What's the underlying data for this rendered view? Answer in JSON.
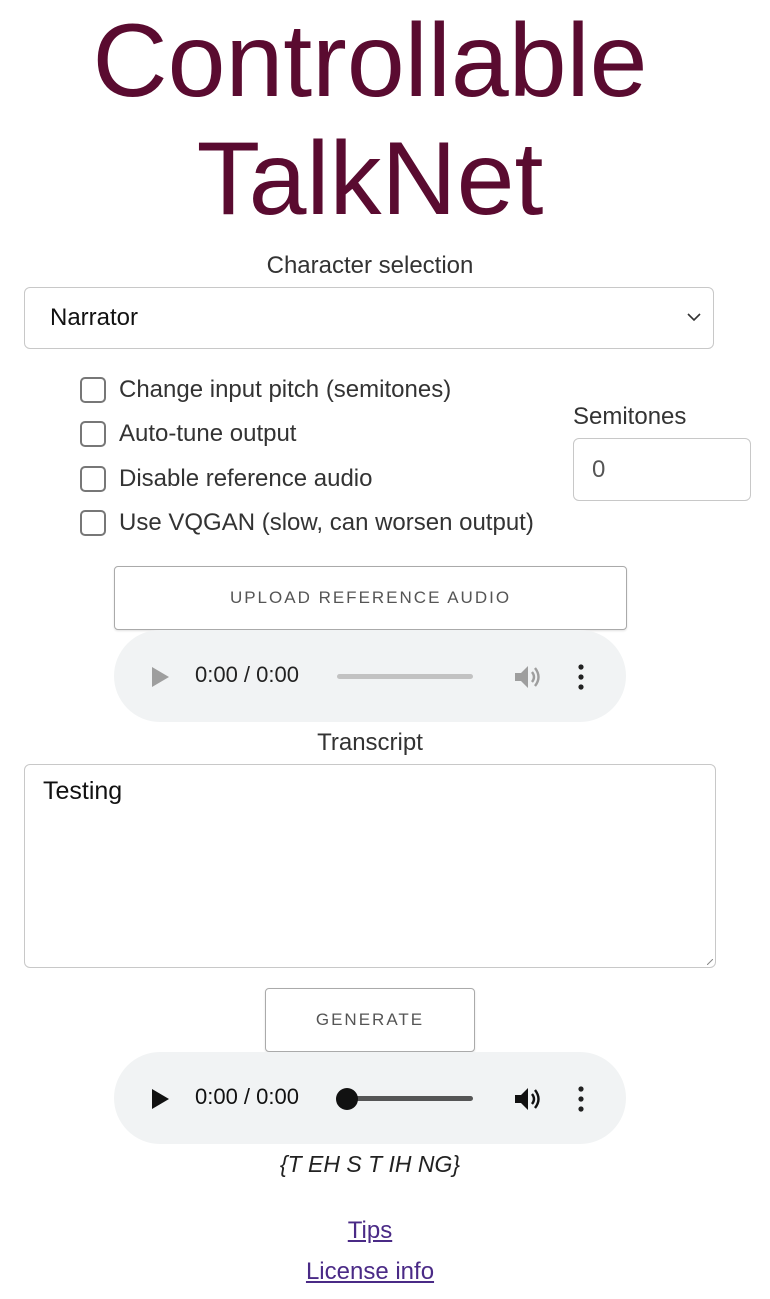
{
  "app": {
    "title_line1": "Controllable",
    "title_line2": "TalkNet"
  },
  "character": {
    "label": "Character selection",
    "selected": "Narrator"
  },
  "options": {
    "items": [
      {
        "label": "Change input pitch (semitones)",
        "checked": false
      },
      {
        "label": "Auto-tune output",
        "checked": false
      },
      {
        "label": "Disable reference audio",
        "checked": false
      },
      {
        "label": "Use VQGAN (slow, can worsen output)",
        "checked": false
      }
    ],
    "semitones_label": "Semitones",
    "semitones_value": "0"
  },
  "reference": {
    "upload_label": "UPLOAD REFERENCE AUDIO",
    "player_time": "0:00 / 0:00",
    "enabled": false
  },
  "transcript": {
    "label": "Transcript",
    "value": "Testing"
  },
  "generate": {
    "button_label": "GENERATE",
    "player_time": "0:00 / 0:00",
    "enabled": true,
    "arpabet": "{T EH S T IH NG}"
  },
  "links": {
    "tips": "Tips",
    "license": "License info"
  },
  "colors": {
    "title": "#5a0b30",
    "link": "#4a2a86",
    "player_bg": "#f1f3f4"
  }
}
